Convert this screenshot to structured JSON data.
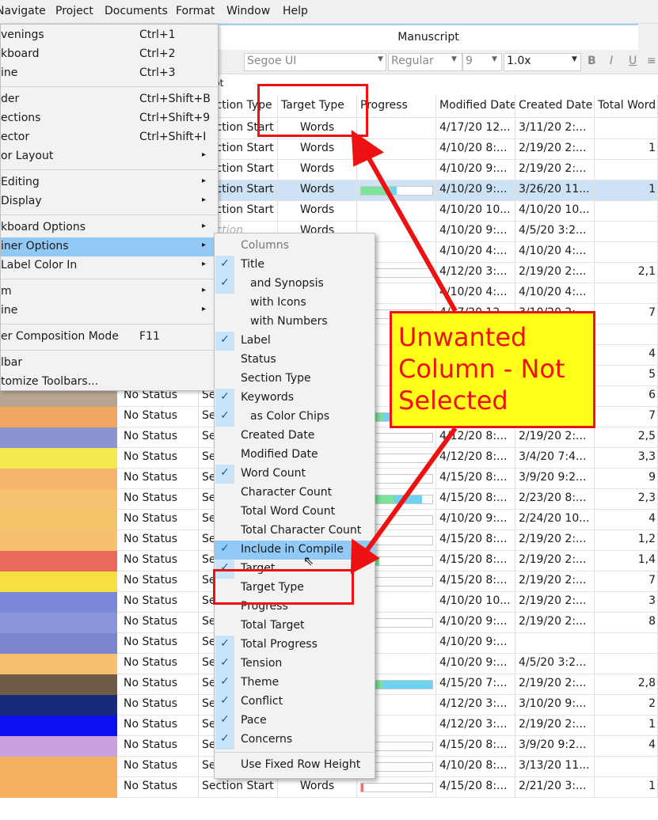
{
  "menubar": [
    "Navigate",
    "Project",
    "Documents",
    "Format",
    "Window",
    "Help"
  ],
  "tab_title": "Manuscript",
  "format_bar": {
    "font": "Segoe UI",
    "weight": "Regular",
    "size": "9",
    "spacing": "1.0x",
    "bold": "B",
    "italic": "I",
    "underline": "U"
  },
  "subbar_text": "pt",
  "columns": [
    "Section Type",
    "Target Type",
    "Progress",
    "Modified Date",
    "Created Date",
    "Total Word"
  ],
  "rows": [
    {
      "status": "",
      "stype": "Section Start",
      "ttype": "Words",
      "prog": 0,
      "prog2": 0,
      "mod": "4/17/20 12...",
      "cre": "3/11/20 2:...",
      "total": "",
      "chip": "#ffffff"
    },
    {
      "status": "",
      "stype": "Section Start",
      "ttype": "Words",
      "prog": 0,
      "prog2": 0,
      "mod": "4/10/20 8:...",
      "cre": "2/19/20 2:...",
      "total": "1",
      "chip": "#ffffff"
    },
    {
      "status": "",
      "stype": "Section Start",
      "ttype": "Words",
      "prog": 0,
      "prog2": 0,
      "mod": "4/10/20 9:...",
      "cre": "2/19/20 2:...",
      "total": "",
      "chip": "#ffffff"
    },
    {
      "status": "",
      "stype": "Section Start",
      "ttype": "Words",
      "prog": 0.42,
      "prog2": 0.08,
      "mod": "4/10/20 9:...",
      "cre": "3/26/20 11...",
      "total": "1",
      "chip": "#ffffff",
      "sel": true
    },
    {
      "status": "",
      "stype": "Section Start",
      "ttype": "Words",
      "prog": 0,
      "prog2": 0,
      "mod": "4/10/20 10...",
      "cre": "4/10/20 10...",
      "total": "",
      "chip": "#ffffff"
    },
    {
      "status": "",
      "stype": "Section",
      "ttype": "Words",
      "prog": 0,
      "prog2": 0,
      "mod": "4/10/20 9:...",
      "cre": "4/5/20 3:2...",
      "total": "",
      "chip": "#ffffff"
    },
    {
      "status": "",
      "stype": "",
      "ttype": "",
      "prog": 0,
      "prog2": 0,
      "mod": "4/10/20 4:...",
      "cre": "4/10/20 4:...",
      "total": "",
      "chip": "#ffffff"
    },
    {
      "status": "",
      "stype": "",
      "ttype": "",
      "prog": 0.1,
      "prog2": 0,
      "mod": "4/12/20 3:...",
      "cre": "2/19/20 2:...",
      "total": "2,1",
      "chip": "#ffffff"
    },
    {
      "status": "",
      "stype": "",
      "ttype": "",
      "prog": 0,
      "prog2": 0,
      "mod": "4/10/20 4:...",
      "cre": "4/10/20 4:...",
      "total": "",
      "chip": "#ffffff"
    },
    {
      "status": "",
      "stype": "",
      "ttype": "",
      "prog": 0.2,
      "prog2": 0,
      "mod": "4/17/20 12...",
      "cre": "3/10/20 2:...",
      "total": "7",
      "chip": "#ffffff"
    },
    {
      "status": "",
      "stype": "",
      "ttype": "",
      "prog": 0,
      "prog2": 0,
      "mod": "",
      "cre": "",
      "total": "",
      "chip": "#ffffff"
    },
    {
      "status": "",
      "stype": "",
      "ttype": "",
      "prog": 0,
      "prog2": 0,
      "mod": "",
      "cre": "",
      "total": "4",
      "chip": "#ffffff"
    },
    {
      "status": "No Status",
      "stype": "Se",
      "ttype": "",
      "prog": 0,
      "prog2": 0,
      "mod": "",
      "cre": "",
      "total": "5",
      "chip": "#b5d99c"
    },
    {
      "status": "No Status",
      "stype": "Se",
      "ttype": "",
      "prog": 0,
      "prog2": 0,
      "mod": "",
      "cre": "",
      "total": "6",
      "chip": "#b8a48f"
    },
    {
      "status": "No Status",
      "stype": "Se",
      "ttype": "",
      "prog": 0.3,
      "prog2": 0.1,
      "mod": "4/10/20 9:...",
      "cre": "2/19/20 2:...",
      "total": "7",
      "chip": "#f0a860"
    },
    {
      "status": "No Status",
      "stype": "Se",
      "ttype": "",
      "prog": 0.15,
      "prog2": 0,
      "mod": "4/12/20 8:...",
      "cre": "2/19/20 2:...",
      "total": "2,5",
      "chip": "#8c93d0"
    },
    {
      "status": "No Status",
      "stype": "Se",
      "ttype": "",
      "prog": 0.2,
      "prog2": 0,
      "mod": "4/12/20 8:...",
      "cre": "3/4/20 7:4...",
      "total": "3,3",
      "chip": "#f5e850"
    },
    {
      "status": "No Status",
      "stype": "Se",
      "ttype": "",
      "prog": 0.2,
      "prog2": 0,
      "mod": "4/15/20 8:...",
      "cre": "3/9/20 9:2...",
      "total": "9",
      "chip": "#f5b56a"
    },
    {
      "status": "No Status",
      "stype": "Se",
      "ttype": "",
      "prog": 0.45,
      "prog2": 0.4,
      "mod": "4/15/20 8:...",
      "cre": "2/23/20 8:...",
      "total": "2,3",
      "chip": "#f5c270"
    },
    {
      "status": "No Status",
      "stype": "Se",
      "ttype": "",
      "prog": 0.1,
      "prog2": 0,
      "mod": "4/10/20 9:...",
      "cre": "2/24/20 10...",
      "total": "4",
      "chip": "#f5c56a"
    },
    {
      "status": "No Status",
      "stype": "Se",
      "ttype": "",
      "prog": 0.2,
      "prog2": 0,
      "mod": "4/15/20 8:...",
      "cre": "2/19/20 2:...",
      "total": "1,2",
      "chip": "#f5c070"
    },
    {
      "status": "No Status",
      "stype": "Se",
      "ttype": "",
      "prog": 0.25,
      "prog2": 0,
      "mod": "4/15/20 8:...",
      "cre": "2/19/20 2:...",
      "total": "1,4",
      "chip": "#e86a5a"
    },
    {
      "status": "No Status",
      "stype": "Se",
      "ttype": "",
      "prog": 0.2,
      "prog2": 0,
      "mod": "4/15/20 8:...",
      "cre": "2/19/20 2:...",
      "total": "7",
      "chip": "#f5e040"
    },
    {
      "status": "No Status",
      "stype": "Se",
      "ttype": "",
      "prog": 0,
      "prog2": 0,
      "mod": "4/10/20 10...",
      "cre": "2/19/20 2:...",
      "total": "3",
      "chip": "#7a88d8"
    },
    {
      "status": "No Status",
      "stype": "Se",
      "ttype": "",
      "prog": 0.15,
      "prog2": 0,
      "mod": "4/10/20 9:...",
      "cre": "2/19/20 2:...",
      "total": "8",
      "chip": "#8a95d8"
    },
    {
      "status": "No Status",
      "stype": "Se",
      "ttype": "",
      "prog": 0,
      "prog2": 0,
      "mod": "4/10/20 9:...",
      "cre": "",
      "total": "",
      "chip": "#7a86d0"
    },
    {
      "status": "No Status",
      "stype": "Se",
      "ttype": "",
      "prog": 0,
      "prog2": 0,
      "mod": "4/10/20 9:...",
      "cre": "4/5/20 3:2...",
      "total": "",
      "chip": "#f5c070"
    },
    {
      "status": "No Status",
      "stype": "Se",
      "ttype": "",
      "prog": 0.3,
      "prog2": 0.7,
      "mod": "4/15/20 7:...",
      "cre": "2/19/20 2:...",
      "total": "2,8",
      "chip": "#705a48"
    },
    {
      "status": "No Status",
      "stype": "Se",
      "ttype": "",
      "prog": 0,
      "prog2": 0,
      "mod": "4/12/20 3:...",
      "cre": "3/10/20 9:...",
      "total": "2",
      "chip": "#1a2a7a"
    },
    {
      "status": "No Status",
      "stype": "Se",
      "ttype": "",
      "prog": 0,
      "prog2": 0,
      "mod": "4/12/20 3:...",
      "cre": "2/19/20 2:...",
      "total": "1",
      "chip": "#0a10f0"
    },
    {
      "status": "No Status",
      "stype": "Se",
      "ttype": "",
      "prog": 0.1,
      "prog2": 0,
      "mod": "4/15/20 8:...",
      "cre": "3/9/20 9:2...",
      "total": "4",
      "chip": "#c9a0e0"
    },
    {
      "status": "No Status",
      "stype": "Section Start",
      "ttype": "Words",
      "prog": 0.03,
      "prog2": 0,
      "mod": "4/10/20 8:...",
      "cre": "3/13/20 11...",
      "total": "",
      "chip": "#f5b060"
    },
    {
      "status": "No Status",
      "stype": "Section Start",
      "ttype": "Words",
      "prog": 0.03,
      "prog2": 0,
      "mod": "4/15/20 8:...",
      "cre": "2/21/20 3:...",
      "total": "1",
      "chip": "#f5b060"
    }
  ],
  "main_menu": [
    {
      "label": "venings",
      "shortcut": "Ctrl+1"
    },
    {
      "label": "kboard",
      "shortcut": "Ctrl+2"
    },
    {
      "label": "ine",
      "shortcut": "Ctrl+3"
    },
    {
      "sep": true
    },
    {
      "label": "der",
      "shortcut": "Ctrl+Shift+B"
    },
    {
      "label": "ections",
      "shortcut": "Ctrl+Shift+9"
    },
    {
      "label": "ector",
      "shortcut": "Ctrl+Shift+I"
    },
    {
      "label": "or Layout",
      "sub": true
    },
    {
      "sep": true
    },
    {
      "label": " Editing",
      "sub": true
    },
    {
      "label": " Display",
      "sub": true
    },
    {
      "sep": true
    },
    {
      "label": "kboard Options",
      "sub": true
    },
    {
      "label": "iner Options",
      "sub": true,
      "hl": true
    },
    {
      "label": " Label Color In",
      "sub": true
    },
    {
      "sep": true
    },
    {
      "label": "m",
      "sub": true
    },
    {
      "label": "ine",
      "sub": true
    },
    {
      "sep": true
    },
    {
      "label": "er Composition Mode",
      "shortcut": "F11"
    },
    {
      "sep": true
    },
    {
      "label": "lbar"
    },
    {
      "label": "tomize Toolbars..."
    }
  ],
  "submenu": [
    {
      "label": "Columns",
      "dim": true,
      "check": false
    },
    {
      "label": "Title",
      "check": true
    },
    {
      "label": "and Synopsis",
      "check": true,
      "indent": true
    },
    {
      "label": "with Icons",
      "check": false,
      "indent": true
    },
    {
      "label": "with Numbers",
      "check": false,
      "indent": true
    },
    {
      "label": "Label",
      "check": true
    },
    {
      "label": "Status",
      "check": false
    },
    {
      "label": "Section Type",
      "check": false
    },
    {
      "label": "Keywords",
      "check": true
    },
    {
      "label": "as Color Chips",
      "check": true,
      "indent": true
    },
    {
      "label": "Created Date",
      "check": false
    },
    {
      "label": "Modified Date",
      "check": false
    },
    {
      "label": "Word Count",
      "check": true
    },
    {
      "label": "Character Count",
      "check": false
    },
    {
      "label": "Total Word Count",
      "check": false
    },
    {
      "label": "Total Character Count",
      "check": false
    },
    {
      "label": "Include in Compile",
      "check": true,
      "hl": true
    },
    {
      "label": "Target",
      "check": true
    },
    {
      "label": "Target Type",
      "check": false
    },
    {
      "label": "Progress",
      "check": false
    },
    {
      "label": "Total Target",
      "check": false
    },
    {
      "label": "Total Progress",
      "check": true
    },
    {
      "label": "Tension",
      "check": true
    },
    {
      "label": "Theme",
      "check": true
    },
    {
      "label": "Conflict",
      "check": true
    },
    {
      "label": "Pace",
      "check": true
    },
    {
      "label": "Concerns",
      "check": true
    },
    {
      "sep": true
    },
    {
      "label": "Use Fixed Row Height",
      "check": false
    }
  ],
  "annotation": "Unwanted Column - Not Selected",
  "colors": {
    "highlight": "#91c9f7",
    "annotation_red": "#ee1111",
    "callout_yellow": "#ffff1a"
  }
}
